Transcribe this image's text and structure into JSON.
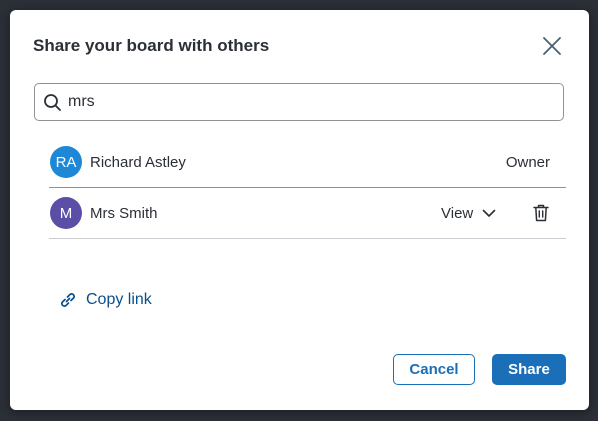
{
  "dialog": {
    "title": "Share your board with others",
    "close_icon": "close-icon"
  },
  "search": {
    "icon": "search-icon",
    "value": "mrs",
    "placeholder": ""
  },
  "users": [
    {
      "initials": "RA",
      "name": "Richard Astley",
      "role": "Owner",
      "avatar_color": "#1e88d6"
    },
    {
      "initials": "M",
      "name": "Mrs Smith",
      "role": "View",
      "avatar_color": "#5b4ea6",
      "role_icon": "chevron-down-icon",
      "remove_icon": "trash-icon"
    }
  ],
  "copy_link": {
    "icon": "link-icon",
    "label": "Copy link"
  },
  "buttons": {
    "cancel": "Cancel",
    "share": "Share"
  },
  "colors": {
    "primary": "#1a6fb8",
    "link": "#0b4f8a",
    "text": "#2b2f36",
    "backdrop": "#2b2f36"
  }
}
